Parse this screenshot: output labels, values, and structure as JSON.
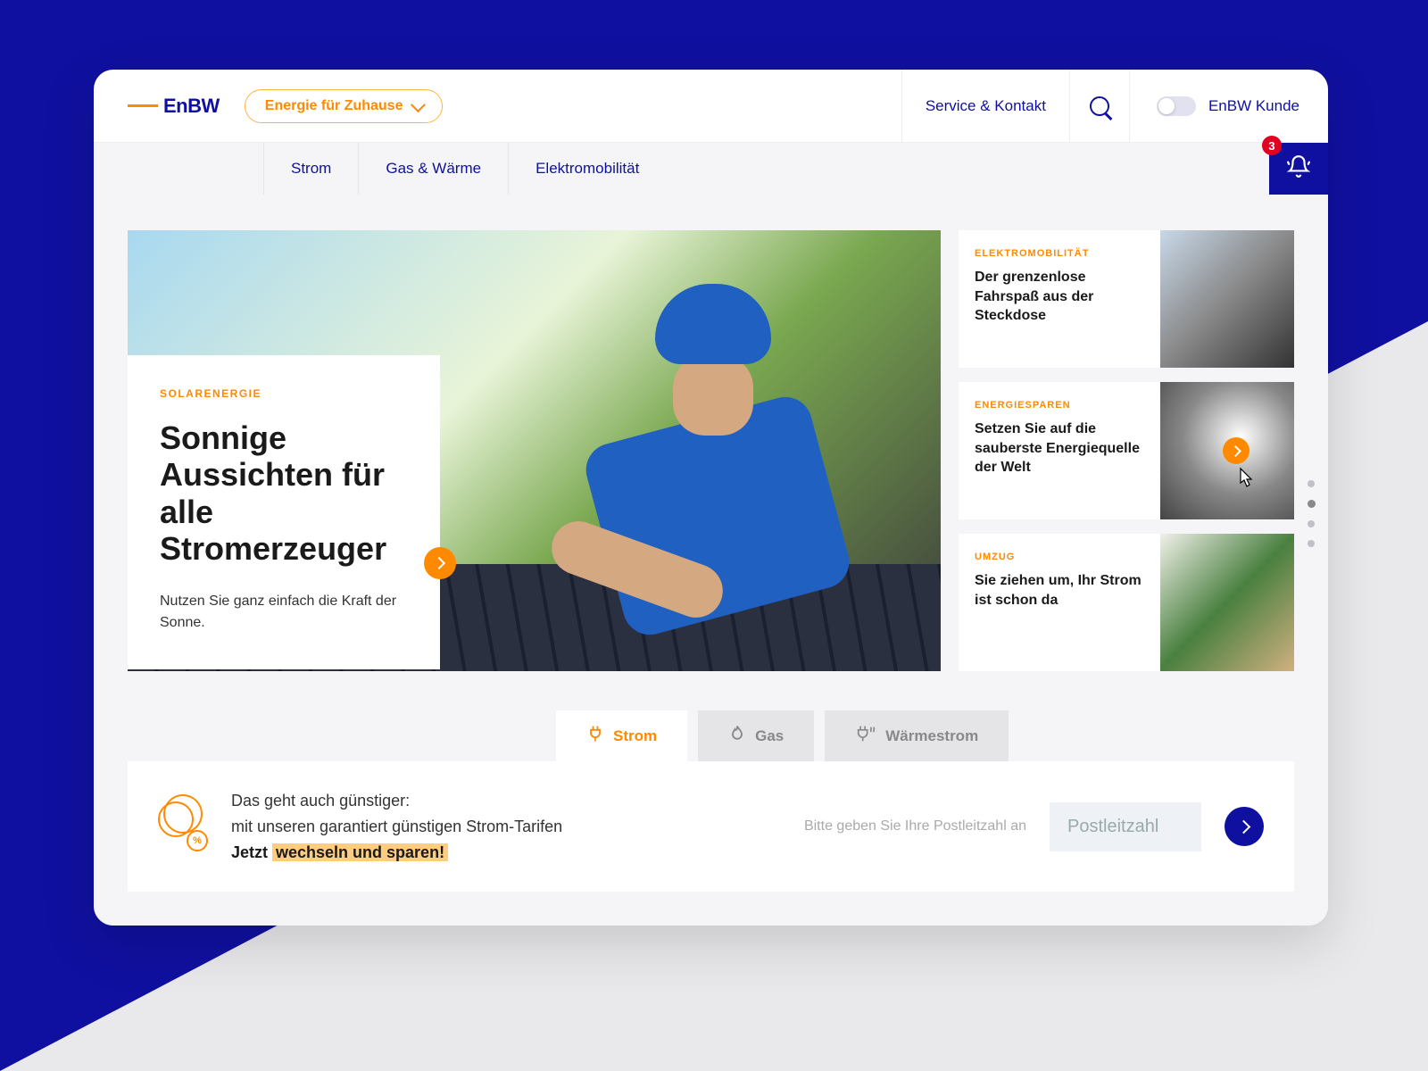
{
  "brand": "EnBW",
  "header": {
    "dropdown": "Energie für Zuhause",
    "service_link": "Service & Kontakt",
    "toggle_label": "EnBW Kunde"
  },
  "subnav": {
    "items": [
      "Strom",
      "Gas & Wärme",
      "Elektromobilität"
    ],
    "notif_count": "3"
  },
  "hero": {
    "eyebrow": "SOLARENERGIE",
    "title": "Sonnige Aussichten für alle Stromerzeuger",
    "subtitle": "Nutzen Sie ganz einfach die Kraft der Sonne."
  },
  "side": [
    {
      "eyebrow": "ELEKTROMOBILITÄT",
      "title": "Der grenzenlose Fahrspaß aus der Steckdose"
    },
    {
      "eyebrow": "ENERGIESPAREN",
      "title": "Setzen Sie auf die sauberste Energiequelle der Welt"
    },
    {
      "eyebrow": "UMZUG",
      "title": "Sie ziehen um, Ihr Strom ist schon da"
    }
  ],
  "tabs": {
    "strom": "Strom",
    "gas": "Gas",
    "waerme": "Wärmestrom"
  },
  "promo": {
    "line1": "Das geht auch günstiger:",
    "line2": "mit unseren garantiert günstigen Strom-Tarifen",
    "cta_prefix": "Jetzt ",
    "cta_highlight": "wechseln und sparen!",
    "input_label": "Bitte geben Sie Ihre Postleitzahl an",
    "input_placeholder": "Postleitzahl"
  }
}
